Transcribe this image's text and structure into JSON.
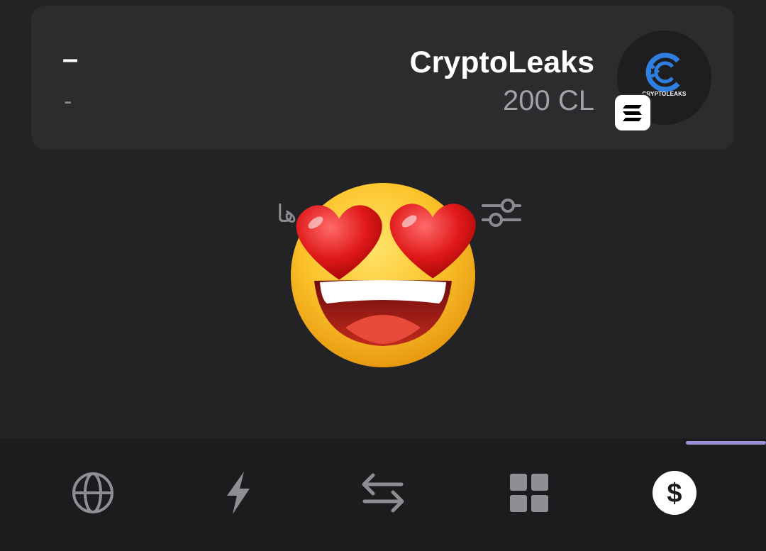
{
  "token_card": {
    "left_value": "–",
    "left_sub": "-",
    "token_name": "CryptoLeaks",
    "token_amount": "200 CL",
    "logo_text": "CRYPTOLEAKS",
    "chain_badge_icon": "solana-icon"
  },
  "filter": {
    "label": "فیلتر توکن‌ها",
    "icon": "sliders-icon"
  },
  "emoji": {
    "icon": "heart-eyes-emoji"
  },
  "nav": {
    "items": [
      {
        "icon": "globe-icon"
      },
      {
        "icon": "lightning-icon"
      },
      {
        "icon": "swap-arrows-icon"
      },
      {
        "icon": "grid-icon"
      },
      {
        "icon": "dollar-icon",
        "active": true
      }
    ]
  },
  "colors": {
    "background": "#232325",
    "card": "#2c2c2f",
    "nav_background": "#1c1c1e",
    "indicator": "#9b8fd8",
    "logo_blue": "#2e7fe0"
  }
}
